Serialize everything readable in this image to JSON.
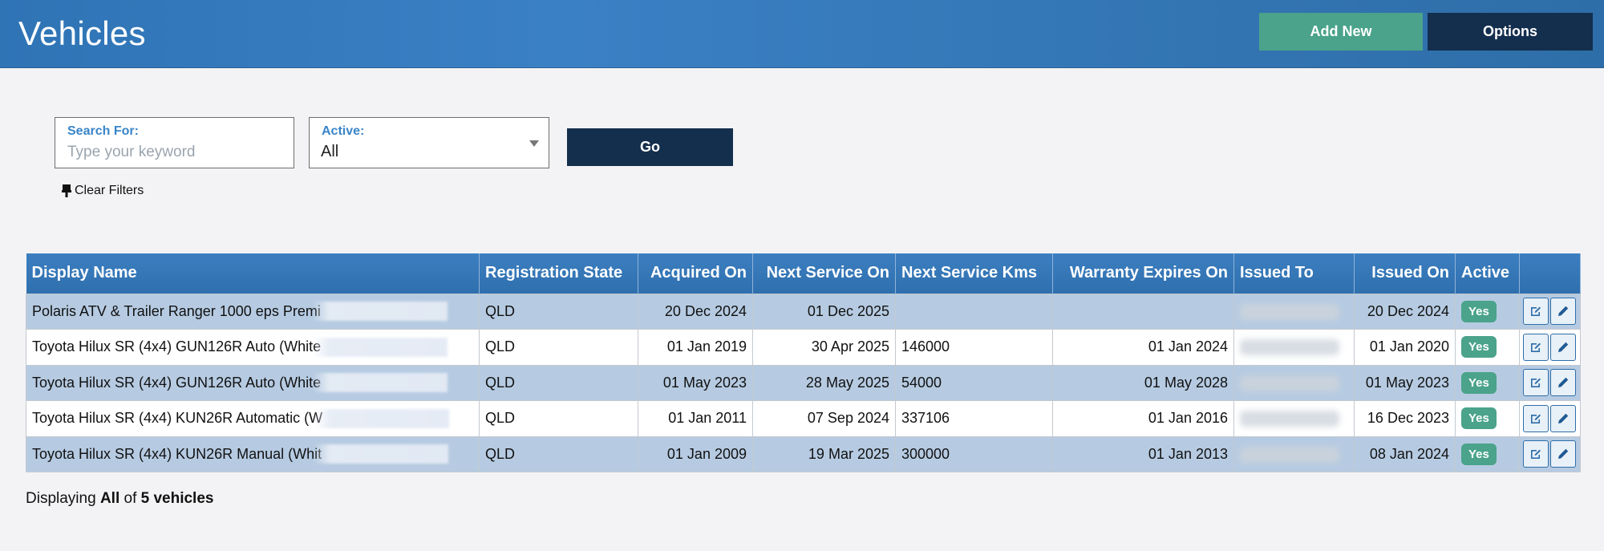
{
  "header": {
    "title": "Vehicles",
    "add_new_label": "Add New",
    "options_label": "Options"
  },
  "filters": {
    "search_label": "Search For:",
    "search_placeholder": "Type your keyword",
    "search_value": "",
    "active_label": "Active:",
    "active_value": "All",
    "go_label": "Go",
    "clear_label": "Clear Filters"
  },
  "table": {
    "columns": [
      "Display Name",
      "Registration State",
      "Acquired On",
      "Next Service On",
      "Next Service Kms",
      "Warranty Expires On",
      "Issued To",
      "Issued On",
      "Active",
      ""
    ],
    "rows": [
      {
        "display_name": "Polaris ATV & Trailer Ranger 1000 eps Premi",
        "state": "QLD",
        "acquired": "20 Dec 2024",
        "next_service": "01 Dec 2025",
        "kms": "",
        "warranty": "",
        "issued_on": "20 Dec 2024",
        "active": "Yes"
      },
      {
        "display_name": "Toyota Hilux SR (4x4) GUN126R Auto (White",
        "state": "QLD",
        "acquired": "01 Jan 2019",
        "next_service": "30 Apr 2025",
        "kms": "146000",
        "warranty": "01 Jan 2024",
        "issued_on": "01 Jan 2020",
        "active": "Yes"
      },
      {
        "display_name": "Toyota Hilux SR (4x4) GUN126R Auto (White",
        "state": "QLD",
        "acquired": "01 May 2023",
        "next_service": "28 May 2025",
        "kms": "54000",
        "warranty": "01 May 2028",
        "issued_on": "01 May 2023",
        "active": "Yes"
      },
      {
        "display_name": "Toyota Hilux SR (4x4) KUN26R Automatic (W",
        "state": "QLD",
        "acquired": "01 Jan 2011",
        "next_service": "07 Sep 2024",
        "kms": "337106",
        "warranty": "01 Jan 2016",
        "issued_on": "16 Dec 2023",
        "active": "Yes"
      },
      {
        "display_name": "Toyota Hilux SR (4x4) KUN26R Manual (Whit",
        "state": "QLD",
        "acquired": "01 Jan 2009",
        "next_service": "19 Mar 2025",
        "kms": "300000",
        "warranty": "01 Jan 2013",
        "issued_on": "08 Jan 2024",
        "active": "Yes"
      }
    ]
  },
  "footer": {
    "prefix": "Displaying ",
    "scope": "All",
    "middle": " of ",
    "count": "5 vehicles"
  },
  "colors": {
    "header_blue": "#2f74b5",
    "add_green": "#4aa38a",
    "navy": "#142e4d",
    "row_alt": "#b6cbe2",
    "label_blue": "#3a85c8"
  },
  "icons": {
    "edit_action": "edit-square-icon",
    "quick_edit_action": "pencil-icon",
    "clear_filters": "broom-icon",
    "active_dropdown": "caret-down-icon"
  }
}
